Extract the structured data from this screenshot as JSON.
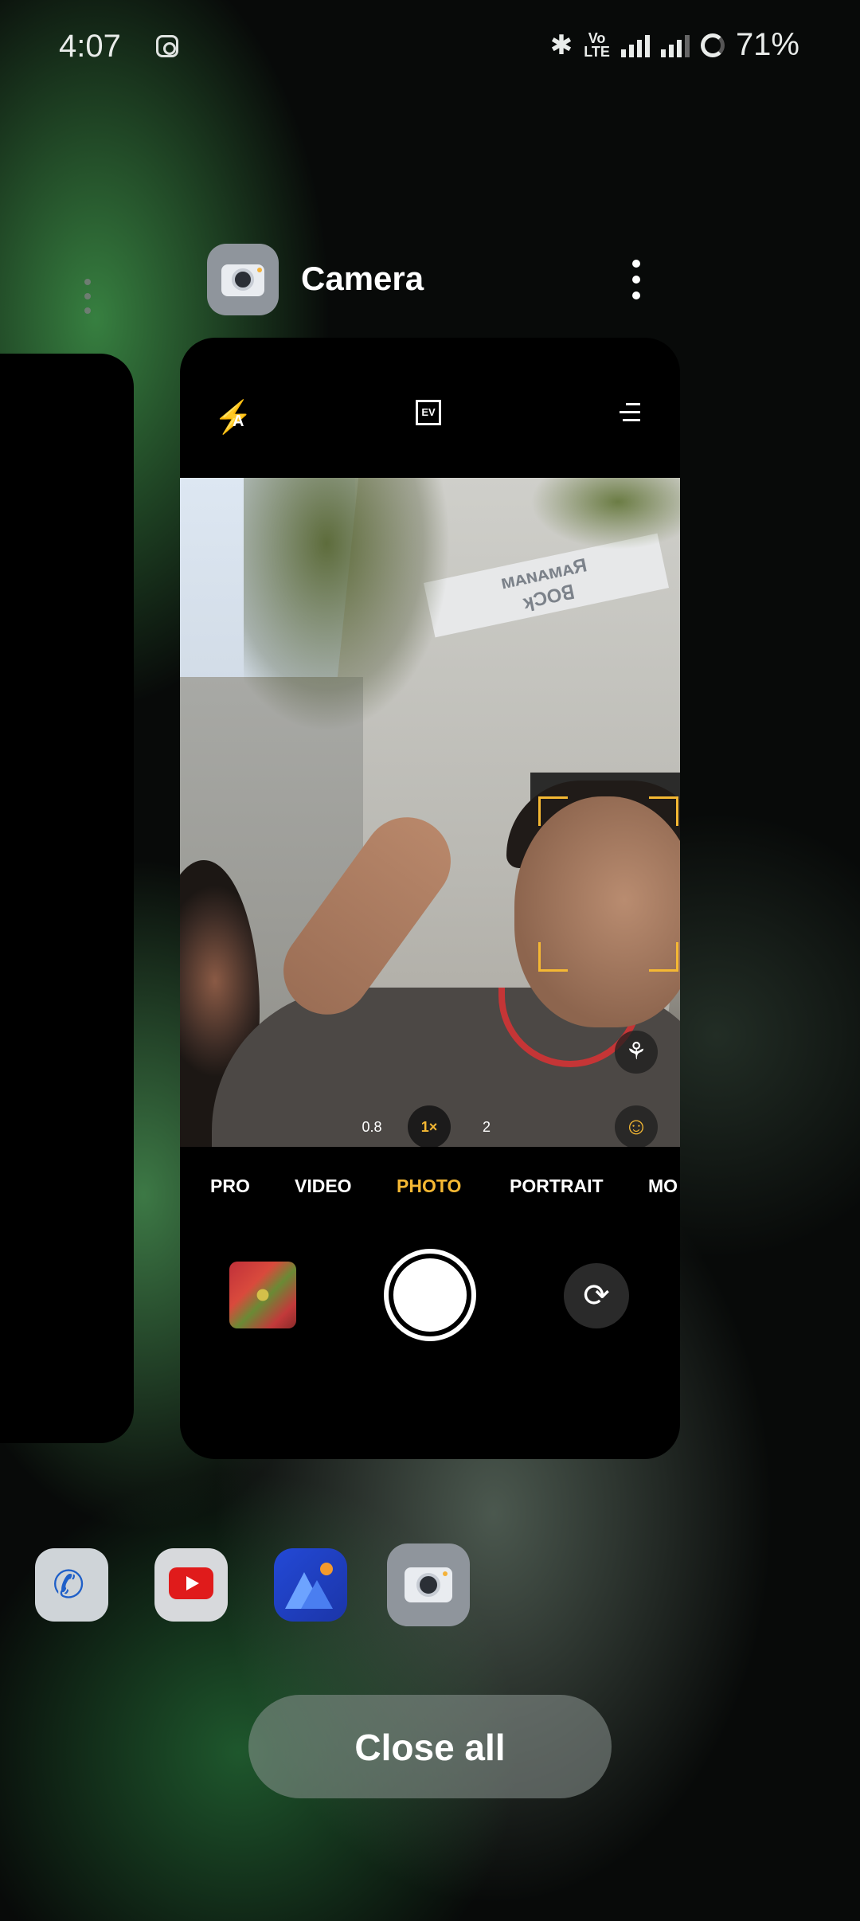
{
  "status_bar": {
    "time": "4:07",
    "battery": "71%",
    "volte": "Vo\nLTE",
    "icons": [
      "instagram-icon",
      "bluetooth-icon",
      "volte-icon",
      "signal-icon",
      "signal-icon",
      "battery-icon"
    ]
  },
  "recent_app": {
    "name": "Camera",
    "icon": "camera-app-icon"
  },
  "camera": {
    "ev_label": "EV",
    "flash_mode": "A",
    "sign_text": "RAMANUJAM\nBLOCK",
    "zoom_levels": [
      "0.8",
      "1×",
      "2"
    ],
    "active_zoom": "1×",
    "modes": [
      "PRO",
      "VIDEO",
      "PHOTO",
      "PORTRAIT",
      "MO"
    ],
    "active_mode": "PHOTO",
    "accent_color": "#f5b833"
  },
  "dock": {
    "apps": [
      "phone-icon",
      "youtube-icon",
      "gallery-icon",
      "camera-icon"
    ]
  },
  "close_all": {
    "label": "Close all"
  }
}
